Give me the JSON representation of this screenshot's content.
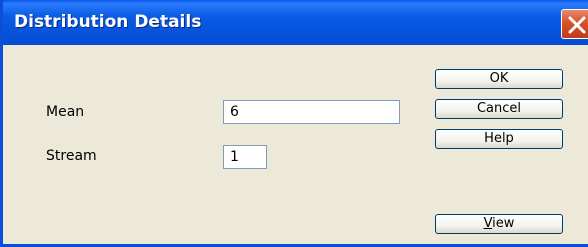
{
  "window": {
    "title": "Distribution Details"
  },
  "fields": {
    "mean": {
      "label": "Mean",
      "value": "6"
    },
    "stream": {
      "label": "Stream",
      "value": "1"
    }
  },
  "buttons": {
    "ok": "OK",
    "cancel": "Cancel",
    "help": "Help",
    "view_mnemonic": "V",
    "view_rest": "iew"
  },
  "icons": {
    "close": "close-icon"
  },
  "colors": {
    "titlebar": "#0753dc",
    "close_button": "#d7512c",
    "dialog_background": "#ece9d8"
  }
}
